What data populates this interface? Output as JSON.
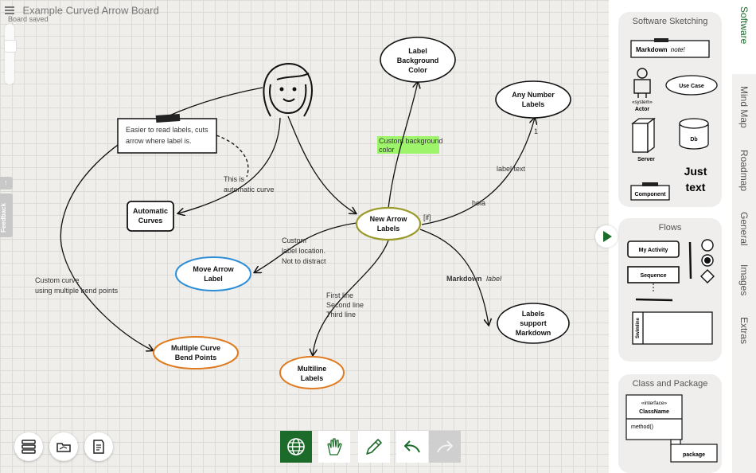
{
  "header": {
    "title": "Example Curved Arrow Board",
    "status": "Board saved"
  },
  "left_tab": {
    "feedback": "Feedback"
  },
  "diagram": {
    "nodes": {
      "note": [
        "Easier to read labels, cuts",
        "arrow where label is."
      ],
      "label_bg": [
        "Label",
        "Background",
        "Color"
      ],
      "any_number": [
        "Any Number",
        "Labels"
      ],
      "auto_curves": [
        "Automatic",
        "Curves"
      ],
      "new_arrow": [
        "New Arrow",
        "Labels"
      ],
      "move_arrow": [
        "Move Arrow",
        "Label"
      ],
      "multi_curve": [
        "Multiple Curve",
        "Bend Points"
      ],
      "multiline": [
        "Multiline",
        "Labels"
      ],
      "markdown": [
        "Labels",
        "support",
        "Markdown"
      ]
    },
    "labels": {
      "custom_bg": [
        "Custom background",
        "color"
      ],
      "label_text": "label text",
      "one": "1",
      "if": "[if]",
      "hola": "hola",
      "this_is": [
        "This is",
        "automatic curve"
      ],
      "custom_loc": [
        "Custom",
        "label location.",
        "Not to distract"
      ],
      "custom_curve": [
        "Custom curve",
        "using multiple bend points"
      ],
      "multi_lines": [
        "First line",
        "Second line",
        "Third line"
      ],
      "markdown_bold": "Markdown",
      "markdown_italic": "label"
    }
  },
  "panel": {
    "software": {
      "title": "Software Sketching",
      "markdown_note_bold": "Markdown",
      "markdown_note_italic": "note!",
      "use_case": "Use Case",
      "system_tag": "«system»",
      "actor": "Actor",
      "db": "Db",
      "server": "Server",
      "component": "Component",
      "just_text": [
        "Just",
        "text"
      ]
    },
    "flows": {
      "title": "Flows",
      "my_activity": "My Activity",
      "sequence": "Sequence",
      "swimline": "Swimline"
    },
    "class_package": {
      "title": "Class and Package",
      "interface": "«interface»",
      "classname": "ClassName",
      "method": "method()",
      "package": "package"
    }
  },
  "tabs": [
    "Software",
    "Mind Map",
    "Roadmap",
    "General",
    "Images",
    "Extras"
  ],
  "active_tab": "Software",
  "colors": {
    "accent": "#1c6b2a",
    "highlight": "#9ef56c",
    "blue": "#2d8ed8",
    "orange": "#e07a1f",
    "olive": "#9a9a2a"
  }
}
